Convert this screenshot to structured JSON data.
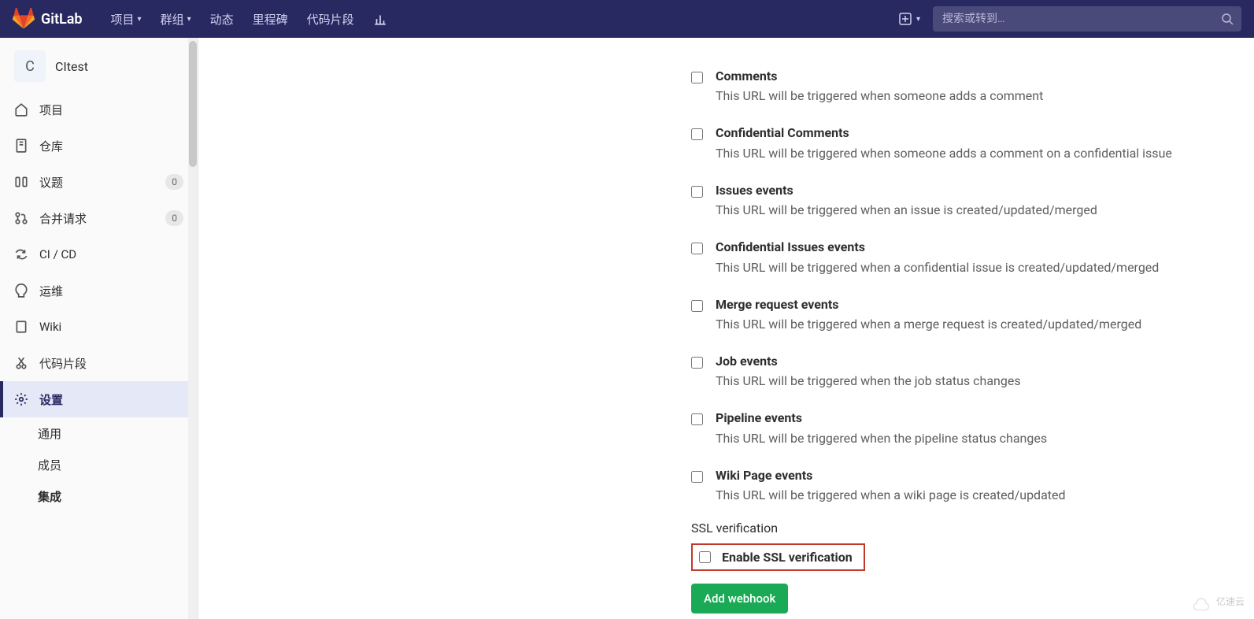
{
  "topnav": {
    "brand": "GitLab",
    "items": [
      "项目",
      "群组",
      "动态",
      "里程碑",
      "代码片段"
    ],
    "search_placeholder": "搜索或转到…"
  },
  "sidebar": {
    "project_initial": "C",
    "project_name": "CItest",
    "items": [
      {
        "icon": "home",
        "label": "项目",
        "badge": null
      },
      {
        "icon": "repo",
        "label": "仓库",
        "badge": null
      },
      {
        "icon": "issues",
        "label": "议题",
        "badge": "0"
      },
      {
        "icon": "mr",
        "label": "合并请求",
        "badge": "0"
      },
      {
        "icon": "cicd",
        "label": "CI / CD",
        "badge": null
      },
      {
        "icon": "ops",
        "label": "运维",
        "badge": null
      },
      {
        "icon": "wiki",
        "label": "Wiki",
        "badge": null
      },
      {
        "icon": "snippets",
        "label": "代码片段",
        "badge": null
      },
      {
        "icon": "settings",
        "label": "设置",
        "badge": null,
        "active": true
      }
    ],
    "sub_items": [
      "通用",
      "成员",
      "集成"
    ],
    "sub_active_index": 2
  },
  "triggers": [
    {
      "label": "Comments",
      "desc": "This URL will be triggered when someone adds a comment"
    },
    {
      "label": "Confidential Comments",
      "desc": "This URL will be triggered when someone adds a comment on a confidential issue"
    },
    {
      "label": "Issues events",
      "desc": "This URL will be triggered when an issue is created/updated/merged"
    },
    {
      "label": "Confidential Issues events",
      "desc": "This URL will be triggered when a confidential issue is created/updated/merged"
    },
    {
      "label": "Merge request events",
      "desc": "This URL will be triggered when a merge request is created/updated/merged"
    },
    {
      "label": "Job events",
      "desc": "This URL will be triggered when the job status changes"
    },
    {
      "label": "Pipeline events",
      "desc": "This URL will be triggered when the pipeline status changes"
    },
    {
      "label": "Wiki Page events",
      "desc": "This URL will be triggered when a wiki page is created/updated"
    }
  ],
  "ssl": {
    "heading": "SSL verification",
    "label": "Enable SSL verification"
  },
  "button": {
    "add": "Add webhook"
  },
  "watermark": "亿速云"
}
